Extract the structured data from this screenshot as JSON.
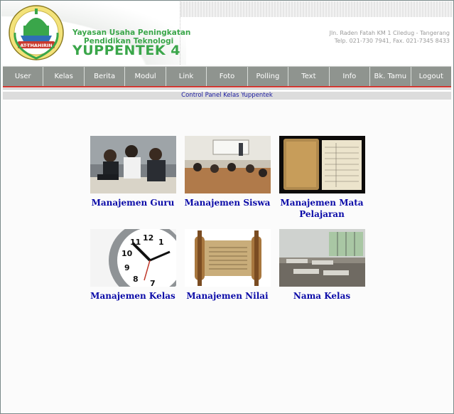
{
  "header": {
    "org_line1": "Yayasan Usaha Peningkatan",
    "org_line2": "Pendidikan Teknologi",
    "brand": "YUPPENTEK 4",
    "logo_text": "AT-THAHIRIN",
    "address_line1": "Jln. Raden Fatah KM 1 Ciledug - Tangerang",
    "address_line2": "Telp. 021-730 7941, Fax. 021-7345 8433"
  },
  "nav": {
    "items": [
      "User",
      "Kelas",
      "Berita",
      "Modul",
      "Link",
      "Foto",
      "Polling",
      "Text",
      "Info",
      "Bk. Tamu",
      "Logout"
    ]
  },
  "control_panel": {
    "title": "Control Panel Kelas Yuppentek"
  },
  "modules": [
    {
      "label": "Manajemen Guru",
      "image": "teachers-at-computer-photo"
    },
    {
      "label": "Manajemen Siswa",
      "image": "classroom-students-photo"
    },
    {
      "label": "Manajemen Mata Pelajaran",
      "image": "old-ledger-book-photo"
    },
    {
      "label": "Manajemen Kelas",
      "image": "wall-clock-photo"
    },
    {
      "label": "Manajemen Nilai",
      "image": "scroll-photo"
    },
    {
      "label": "Nama Kelas",
      "image": "empty-classroom-photo"
    }
  ],
  "colors": {
    "nav_bg": "#8f948f",
    "accent_red": "#d2352e",
    "brand_green": "#3aa64a",
    "link_blue": "#0b0ba8"
  }
}
